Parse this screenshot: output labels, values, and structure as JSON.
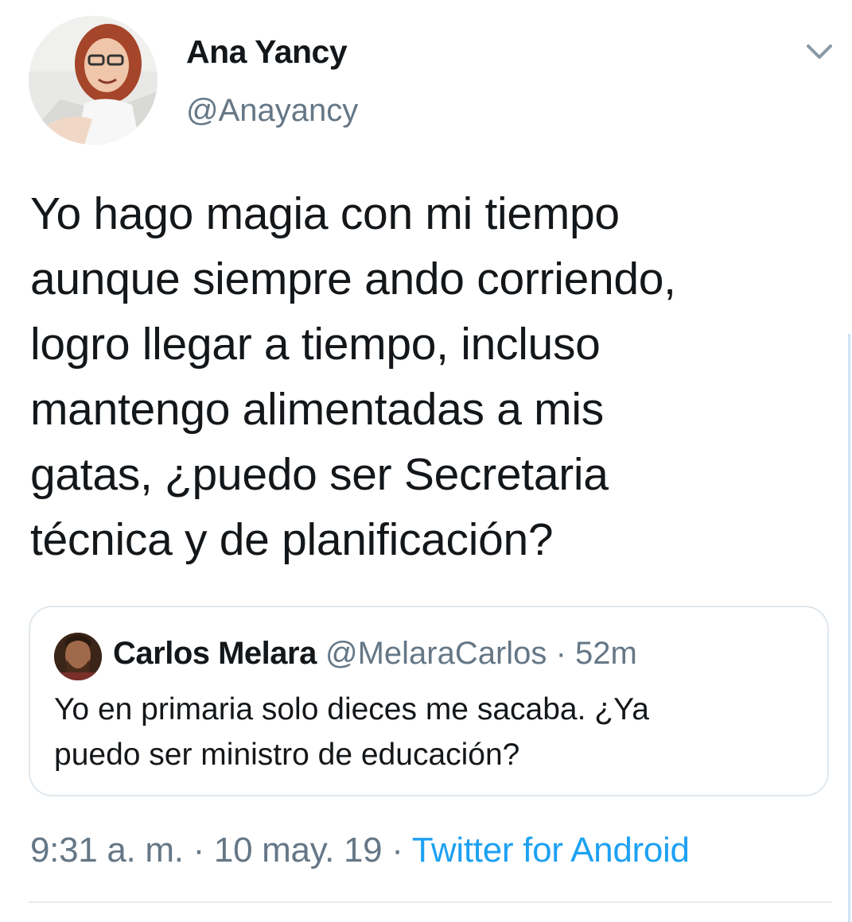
{
  "author": {
    "name": "Ana Yancy",
    "handle": "@Anayancy"
  },
  "tweet": {
    "text": "Yo hago magia con mi tiempo\naunque siempre ando corriendo,\nlogro llegar a tiempo, incluso\nmantengo alimentadas a mis\ngatas, ¿puedo ser Secretaria\ntécnica y de planificación?"
  },
  "quoted_tweet": {
    "name": "Carlos Melara",
    "handle": "@MelaraCarlos",
    "separator": "·",
    "time": "52m",
    "text": "Yo en primaria solo dieces me sacaba. ¿Ya\npuedo ser ministro de educación?"
  },
  "meta": {
    "time": "9:31 a. m.",
    "separator": "·",
    "date": "10 may. 19",
    "source": "Twitter for Android"
  },
  "icons": {
    "caret": "chevron-down-icon"
  },
  "colors": {
    "text": "#14171a",
    "secondary": "#657786",
    "link": "#1da1f2",
    "border": "#e1e8ed"
  }
}
